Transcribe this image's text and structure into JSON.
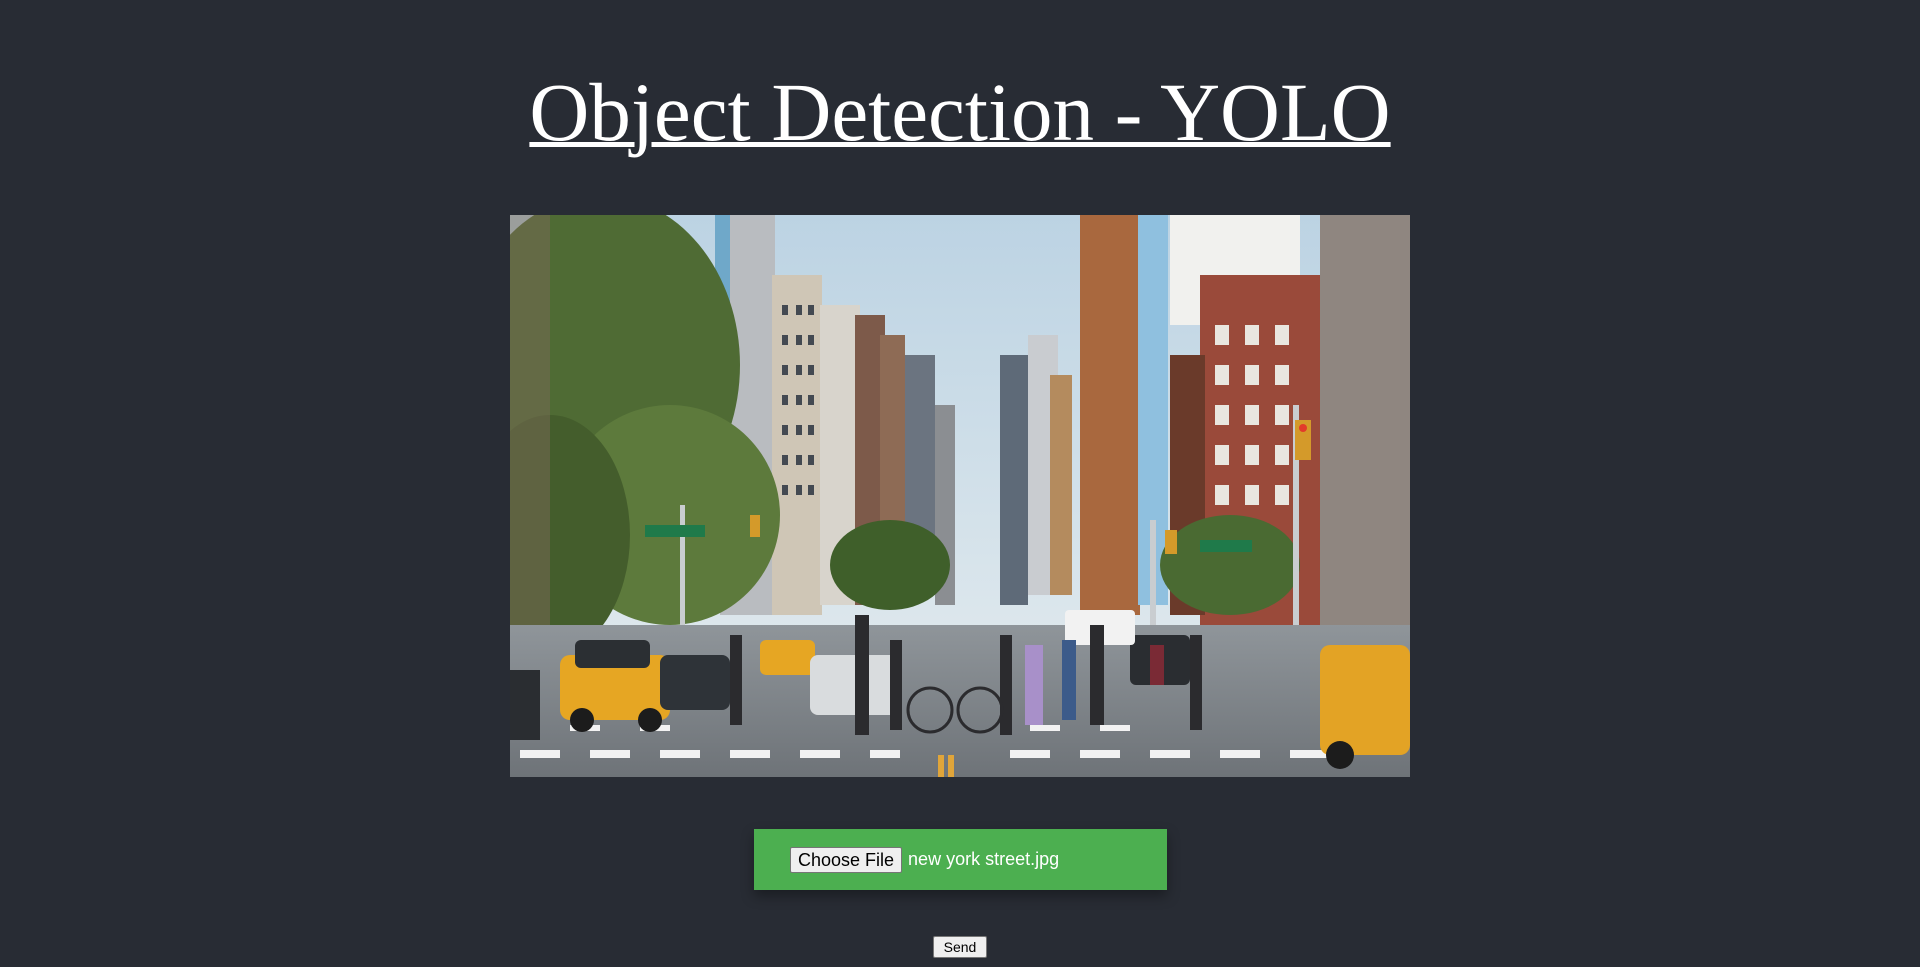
{
  "page": {
    "title": "Object Detection - YOLO",
    "background_color": "#282c34"
  },
  "image": {
    "description_icon": "city-street-photo",
    "alt": ""
  },
  "upload": {
    "button_label": "Choose File",
    "file_name": "new york street.jpg",
    "box_color": "#4caf50"
  },
  "actions": {
    "send_label": "Send"
  }
}
